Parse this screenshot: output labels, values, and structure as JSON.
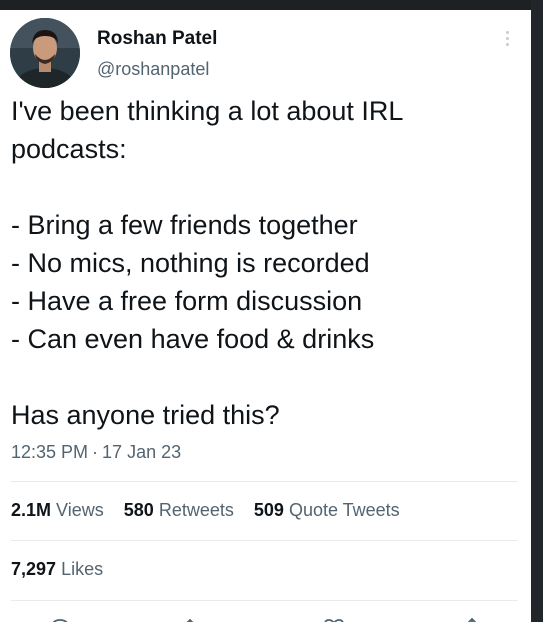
{
  "author": {
    "display_name": "Roshan Patel",
    "handle": "@roshanpatel",
    "avatar_icon": "user-avatar"
  },
  "tweet": {
    "lines": [
      "I've been thinking a lot about IRL",
      "podcasts:",
      "",
      "- Bring a few friends together",
      "- No mics, nothing is recorded",
      "- Have a free form discussion",
      "- Can even have food & drinks",
      "",
      "Has anyone tried this?"
    ],
    "time": "12:35 PM",
    "separator": "·",
    "date": "17 Jan 23"
  },
  "stats": {
    "views_count": "2.1M",
    "views_label": "Views",
    "retweets_count": "580",
    "retweets_label": "Retweets",
    "quotes_count": "509",
    "quotes_label": "Quote Tweets",
    "likes_count": "7,297",
    "likes_label": "Likes"
  },
  "actions": [
    "reply-icon",
    "retweet-icon",
    "like-icon",
    "share-icon"
  ],
  "colors": {
    "text": "#0f1419",
    "secondary": "#536471",
    "divider": "#e6ecf0"
  }
}
